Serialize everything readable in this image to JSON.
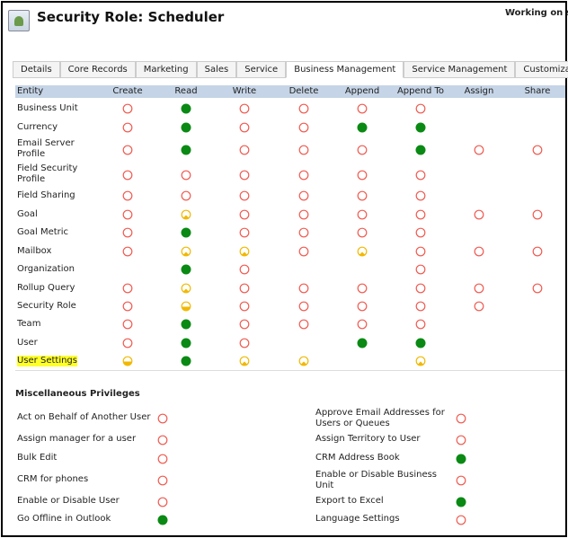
{
  "header": {
    "title": "Security Role: Scheduler",
    "status": "Working on s",
    "icon": "security-role-icon"
  },
  "tabs": [
    {
      "label": "Details"
    },
    {
      "label": "Core Records"
    },
    {
      "label": "Marketing"
    },
    {
      "label": "Sales"
    },
    {
      "label": "Service"
    },
    {
      "label": "Business Management",
      "active": true
    },
    {
      "label": "Service Management"
    },
    {
      "label": "Customizati"
    }
  ],
  "columns": [
    "Entity",
    "Create",
    "Read",
    "Write",
    "Delete",
    "Append",
    "Append To",
    "Assign",
    "Share"
  ],
  "level_colors": {
    "none": "#f05a50",
    "user": "#f2b800",
    "bu": "#f2b800",
    "org": "#0a8a14"
  },
  "rows": [
    {
      "entity": "Business Unit",
      "p": [
        "none",
        "org",
        "none",
        "none",
        "none",
        "none",
        "",
        ""
      ]
    },
    {
      "entity": "Currency",
      "p": [
        "none",
        "org",
        "none",
        "none",
        "org",
        "org",
        "",
        ""
      ]
    },
    {
      "entity": "Email Server Profile",
      "p": [
        "none",
        "org",
        "none",
        "none",
        "none",
        "org",
        "none",
        "none"
      ]
    },
    {
      "entity": "Field Security Profile",
      "p": [
        "none",
        "none",
        "none",
        "none",
        "none",
        "none",
        "",
        ""
      ]
    },
    {
      "entity": "Field Sharing",
      "p": [
        "none",
        "none",
        "none",
        "none",
        "none",
        "none",
        "",
        ""
      ]
    },
    {
      "entity": "Goal",
      "p": [
        "none",
        "user",
        "none",
        "none",
        "none",
        "none",
        "none",
        "none"
      ]
    },
    {
      "entity": "Goal Metric",
      "p": [
        "none",
        "org",
        "none",
        "none",
        "none",
        "none",
        "",
        ""
      ]
    },
    {
      "entity": "Mailbox",
      "p": [
        "none",
        "user",
        "user",
        "none",
        "user",
        "none",
        "none",
        "none"
      ]
    },
    {
      "entity": "Organization",
      "p": [
        "",
        "org",
        "none",
        "",
        "",
        "none",
        "",
        ""
      ]
    },
    {
      "entity": "Rollup Query",
      "p": [
        "none",
        "user",
        "none",
        "none",
        "none",
        "none",
        "none",
        "none"
      ]
    },
    {
      "entity": "Security Role",
      "p": [
        "none",
        "bu",
        "none",
        "none",
        "none",
        "none",
        "none",
        ""
      ]
    },
    {
      "entity": "Team",
      "p": [
        "none",
        "org",
        "none",
        "none",
        "none",
        "none",
        "",
        ""
      ]
    },
    {
      "entity": "User",
      "p": [
        "none",
        "org",
        "none",
        "",
        "org",
        "org",
        "",
        ""
      ]
    },
    {
      "entity": "User Settings",
      "highlighted": true,
      "p": [
        "bu",
        "org",
        "user",
        "user",
        "",
        "user",
        "",
        ""
      ]
    }
  ],
  "misc": {
    "title": "Miscellaneous Privileges",
    "left": [
      {
        "label": "Act on Behalf of Another User",
        "level": "none"
      },
      {
        "label": "Assign manager for a user",
        "level": "none"
      },
      {
        "label": "Bulk Edit",
        "level": "none"
      },
      {
        "label": "CRM for phones",
        "level": "none"
      },
      {
        "label": "Enable or Disable User",
        "level": "none"
      },
      {
        "label": "Go Offline in Outlook",
        "level": "org"
      }
    ],
    "right": [
      {
        "label": "Approve Email Addresses for Users or Queues",
        "level": "none"
      },
      {
        "label": "Assign Territory to User",
        "level": "none"
      },
      {
        "label": "CRM Address Book",
        "level": "org"
      },
      {
        "label": "Enable or Disable Business Unit",
        "level": "none"
      },
      {
        "label": "Export to Excel",
        "level": "org"
      },
      {
        "label": "Language Settings",
        "level": "none"
      }
    ]
  }
}
